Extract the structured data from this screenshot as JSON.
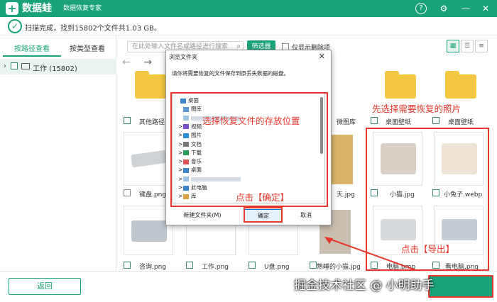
{
  "titlebar": {
    "brand": "数据蛙",
    "subtitle": "数据恢复专家",
    "logo_glyph": "+",
    "help_icon": "?",
    "settings_icon": "⚙",
    "min_icon": "—",
    "close_icon": "✕"
  },
  "status": {
    "text": "扫描完成，找到15802个文件共1.03 GB。",
    "icon": "✓"
  },
  "sidebar": {
    "tabs": [
      "按路径查看",
      "按类型查看"
    ],
    "tree_label": "工作 (15802)"
  },
  "toolbar": {
    "search_placeholder": "在此处输入文件名或路径进行搜索",
    "filter_label": "筛选器",
    "show_deleted_label": "仅显示删除项"
  },
  "grid": {
    "row1": [
      "其他路径",
      "",
      "",
      "",
      "微图库",
      "桌面壁纸",
      "桌面壁纸"
    ],
    "row2": [
      "键盘.png",
      "",
      "",
      "",
      "天.jpg",
      "小猫.jpg",
      "小兔子.webp"
    ],
    "row3": [
      "咨询.png",
      "工作.png",
      "U盘.png",
      "",
      "熟睡的小猫.jpg",
      "电脑.bmp",
      "看电脑.png"
    ]
  },
  "dialog": {
    "title": "浏览文件夹",
    "desc": "请你将需要恢复的文件保存到原丢失数据的磁盘。",
    "tree": [
      {
        "label": "桌面",
        "indent": 0,
        "expander": ""
      },
      {
        "label": "图库",
        "indent": 1,
        "expander": ""
      },
      {
        "label": "",
        "indent": 1,
        "expander": ""
      },
      {
        "label": "视频",
        "indent": 1,
        "expander": ">"
      },
      {
        "label": "图片",
        "indent": 1,
        "expander": ">"
      },
      {
        "label": "文档",
        "indent": 1,
        "expander": ">"
      },
      {
        "label": "下载",
        "indent": 1,
        "expander": ">"
      },
      {
        "label": "音乐",
        "indent": 1,
        "expander": ">"
      },
      {
        "label": "桌面",
        "indent": 1,
        "expander": ">"
      },
      {
        "label": "",
        "indent": 1,
        "expander": ">"
      },
      {
        "label": "此电脑",
        "indent": 1,
        "expander": ">"
      },
      {
        "label": "库",
        "indent": 1,
        "expander": ">"
      }
    ],
    "new_folder_label": "新建文件夹(M)",
    "ok_label": "确定",
    "cancel_label": "取消"
  },
  "annotations": {
    "choose_location": "选择恢复文件的存放位置",
    "click_ok": "点击【确定】",
    "choose_photos": "先选择需要恢复的照片",
    "click_export": "点击【导出】"
  },
  "footer": {
    "back_label": "返回"
  },
  "watermark": "掘金技术社区 @ 小明助手",
  "colors": {
    "accent": "#1aa37a",
    "annotation_red": "#e5372b",
    "folder": "#f5c842"
  }
}
